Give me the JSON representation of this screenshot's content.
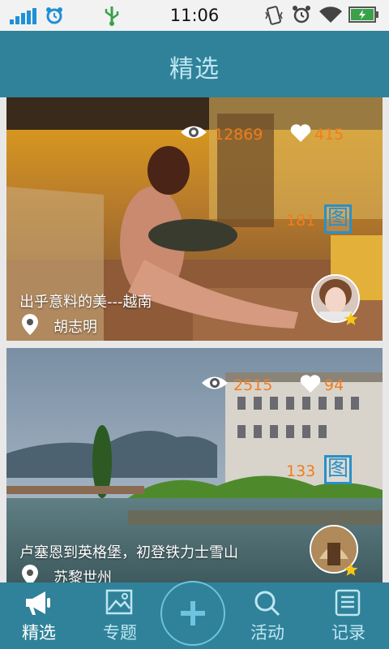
{
  "status_bar": {
    "time": "11:06"
  },
  "header": {
    "title": "精选"
  },
  "feed": [
    {
      "views": "12869",
      "likes": "415",
      "photo_count": "181",
      "gallery_badge": "图",
      "title": "出乎意料的美---越南",
      "author": "胡志明"
    },
    {
      "views": "2515",
      "likes": "94",
      "photo_count": "133",
      "gallery_badge": "图",
      "title": "卢塞恩到英格堡，初登铁力士雪山",
      "author": "苏黎世州"
    }
  ],
  "tabbar": {
    "items": [
      {
        "label": "精选",
        "icon": "megaphone-icon",
        "active": true
      },
      {
        "label": "专题",
        "icon": "picture-icon"
      },
      {
        "label": "活动",
        "icon": "search-icon"
      },
      {
        "label": "记录",
        "icon": "notebook-icon"
      }
    ],
    "add_icon": "plus-icon"
  },
  "colors": {
    "header": "#2f8299",
    "header_text": "#bfe6f2",
    "stat_orange": "#f07d1e",
    "badge_blue": "#2a90c8",
    "star_yellow": "#f5c518"
  }
}
